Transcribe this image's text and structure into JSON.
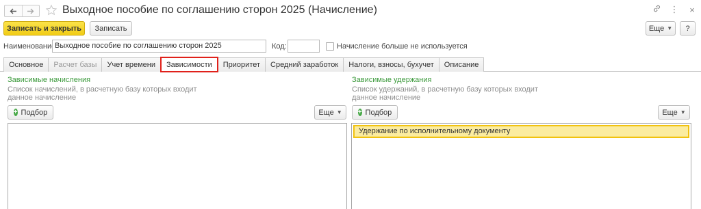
{
  "window": {
    "title": "Выходное пособие по соглашению сторон 2025 (Начисление)",
    "icons": [
      "arrow-left-icon",
      "arrow-right-icon",
      "star-icon",
      "link-icon",
      "more-vert-icon",
      "close-icon"
    ]
  },
  "toolbar": {
    "save_close_label": "Записать и закрыть",
    "save_label": "Записать",
    "more_label": "Еще",
    "help_label": "?"
  },
  "form": {
    "name_label": "Наименование:",
    "name_value": "Выходное пособие по соглашению сторон 2025",
    "code_label": "Код:",
    "code_value": "",
    "not_used_label": "Начисление больше не используется",
    "not_used_checked": false
  },
  "tabs": [
    {
      "label": "Основное",
      "state": "normal"
    },
    {
      "label": "Расчет базы",
      "state": "disabled"
    },
    {
      "label": "Учет времени",
      "state": "normal"
    },
    {
      "label": "Зависимости",
      "state": "active"
    },
    {
      "label": "Приоритет",
      "state": "normal"
    },
    {
      "label": "Средний заработок",
      "state": "normal"
    },
    {
      "label": "Налоги, взносы, бухучет",
      "state": "normal"
    },
    {
      "label": "Описание",
      "state": "normal"
    }
  ],
  "left_panel": {
    "title": "Зависимые начисления",
    "description": "Список начислений, в расчетную базу которых входит данное начисление",
    "pick_label": "Подбор",
    "more_label": "Еще",
    "items": []
  },
  "right_panel": {
    "title": "Зависимые удержания",
    "description": "Список удержаний, в расчетную базу которых входит данное начисление",
    "pick_label": "Подбор",
    "more_label": "Еще",
    "items": [
      "Удержание по исполнительному документу"
    ]
  },
  "colors": {
    "accent_yellow": "#f1cc16",
    "active_tab_border": "#e0211b",
    "group_title": "#3c9a3c",
    "selected_row": "#fbeca0"
  }
}
